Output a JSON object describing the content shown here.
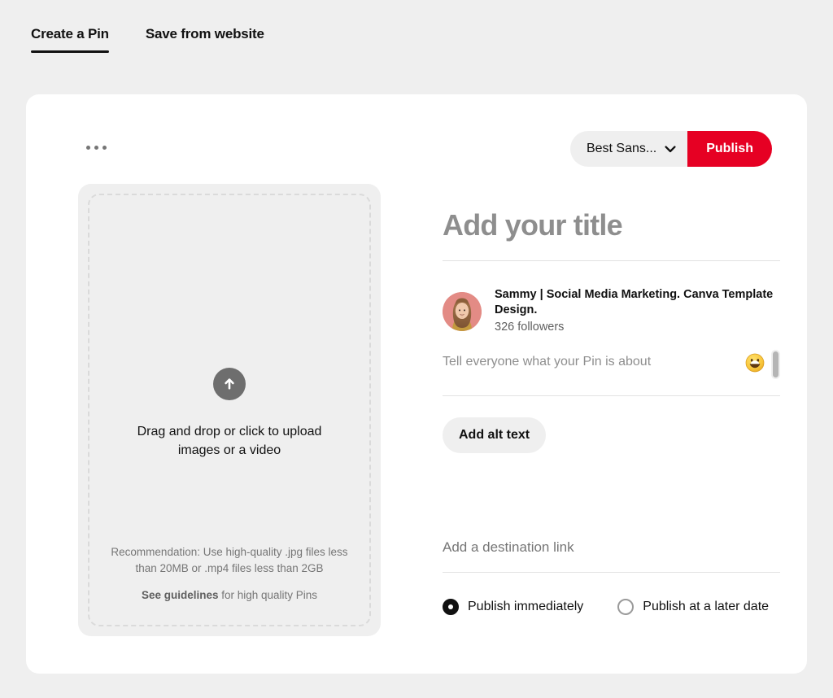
{
  "tabs": [
    {
      "label": "Create a Pin",
      "active": true
    },
    {
      "label": "Save from website",
      "active": false
    }
  ],
  "header": {
    "more_options_icon": "ellipsis-icon",
    "board_select_value": "Best Sans...",
    "board_select_icon": "chevron-down-icon",
    "publish_label": "Publish"
  },
  "upload": {
    "icon": "upload-arrow-icon",
    "prompt": "Drag and drop or click to upload images or a video",
    "recommendation": "Recommendation: Use high-quality .jpg files less than 20MB or .mp4 files less than 2GB",
    "guidelines_link": "See guidelines",
    "guidelines_rest": " for high quality Pins"
  },
  "details": {
    "title_placeholder": "Add your title",
    "profile": {
      "avatar_icon": "user-avatar",
      "name": "Sammy | Social Media Marketing. Canva Template Design.",
      "followers": "326 followers"
    },
    "description_placeholder": "Tell everyone what your Pin is about",
    "emoji_icon": "grinning-face-emoji-icon",
    "scrollbar_icon": "vertical-scrollbar",
    "alt_text_label": "Add alt text",
    "destination_placeholder": "Add a destination link",
    "schedule_options": [
      {
        "label": "Publish immediately",
        "selected": true
      },
      {
        "label": "Publish at a later date",
        "selected": false
      }
    ]
  },
  "colors": {
    "brand_red": "#e60023",
    "page_background": "#efefef",
    "card_background": "#ffffff",
    "text_primary": "#111111",
    "text_muted": "#767676"
  }
}
